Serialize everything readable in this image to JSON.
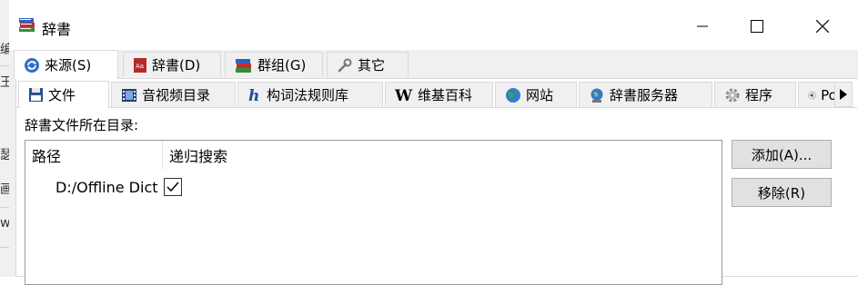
{
  "window": {
    "title": "辞書"
  },
  "background_window": {
    "chars": [
      "编",
      "王",
      "瑟",
      "画",
      "w"
    ]
  },
  "main_tabs": [
    {
      "label": "来源(S)",
      "icon": "refresh-icon",
      "active": true
    },
    {
      "label": "辞書(D)",
      "icon": "dictionary-book-icon",
      "active": false
    },
    {
      "label": "群组(G)",
      "icon": "books-stack-icon",
      "active": false
    },
    {
      "label": "其它",
      "icon": "wrench-icon",
      "active": false
    }
  ],
  "sub_tabs": [
    {
      "label": "文件",
      "icon": "floppy-disk-icon",
      "active": true
    },
    {
      "label": "音视频目录",
      "icon": "film-strip-icon",
      "active": false
    },
    {
      "label": "构词法规则库",
      "icon": "hunspell-h-icon",
      "active": false
    },
    {
      "label": "维基百科",
      "icon": "wikipedia-w-icon",
      "active": false
    },
    {
      "label": "网站",
      "icon": "globe-icon",
      "active": false
    },
    {
      "label": "辞書服务器",
      "icon": "server-globe-icon",
      "active": false
    },
    {
      "label": "程序",
      "icon": "cog-icon",
      "active": false
    },
    {
      "label": "Por",
      "icon": "speaker-icon",
      "active": false
    }
  ],
  "files_panel": {
    "dir_label": "辞書文件所在目录:",
    "columns": [
      "路径",
      "递归搜索"
    ],
    "rows": [
      {
        "path": "D:/Offline Dict",
        "recursive": true
      }
    ],
    "buttons": {
      "add": "添加(A)...",
      "remove": "移除(R)"
    }
  },
  "colors": {
    "window_bg": "#f0f0f0",
    "panel_bg": "#ffffff",
    "border": "#d9d9d9",
    "button_bg": "#e1e1e1"
  }
}
